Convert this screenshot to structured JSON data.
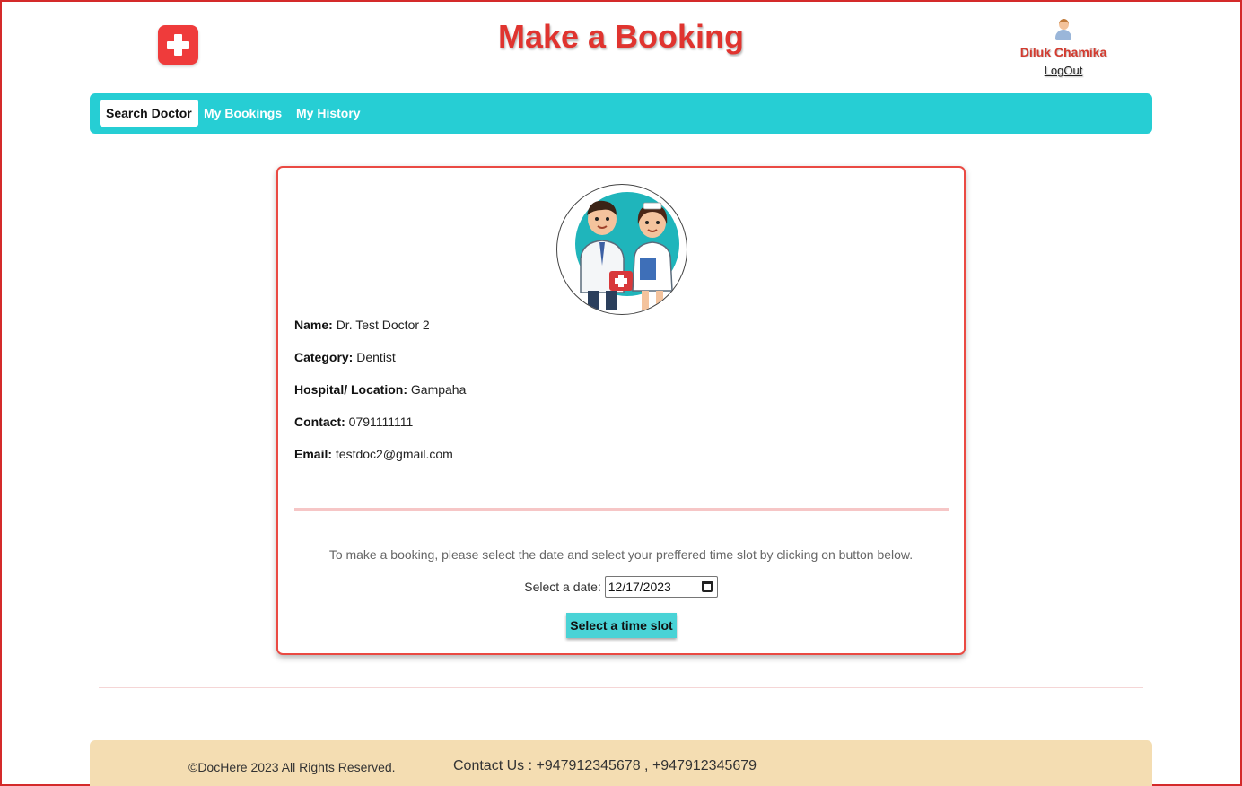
{
  "header": {
    "title": "Make a Booking",
    "user_name": "Diluk Chamika",
    "logout_label": "LogOut"
  },
  "nav": {
    "items": [
      {
        "label": "Search Doctor",
        "active": true
      },
      {
        "label": "My Bookings",
        "active": false
      },
      {
        "label": "My History",
        "active": false
      }
    ]
  },
  "doctor": {
    "name_label": "Name:",
    "name": "Dr. Test Doctor 2",
    "category_label": "Category:",
    "category": "Dentist",
    "location_label": "Hospital/ Location:",
    "location": "Gampaha",
    "contact_label": "Contact:",
    "contact": "0791111111",
    "email_label": "Email:",
    "email": "testdoc2@gmail.com"
  },
  "booking": {
    "note": "To make a booking, please select the date and select your preffered time slot by clicking on button below.",
    "date_label": "Select a date:",
    "date_value": "12/17/2023",
    "slot_button": "Select a time slot"
  },
  "footer": {
    "copyright": "©DocHere 2023 All Rights Reserved.",
    "contact": "Contact Us : +947912345678 , +947912345679"
  },
  "colors": {
    "accent": "#26ced4",
    "brand_red": "#e0342f",
    "footer_bg": "#f4ddb2"
  },
  "icons": {
    "logo": "medical-cross-icon",
    "avatar": "user-avatar-icon",
    "calendar": "calendar-icon"
  }
}
